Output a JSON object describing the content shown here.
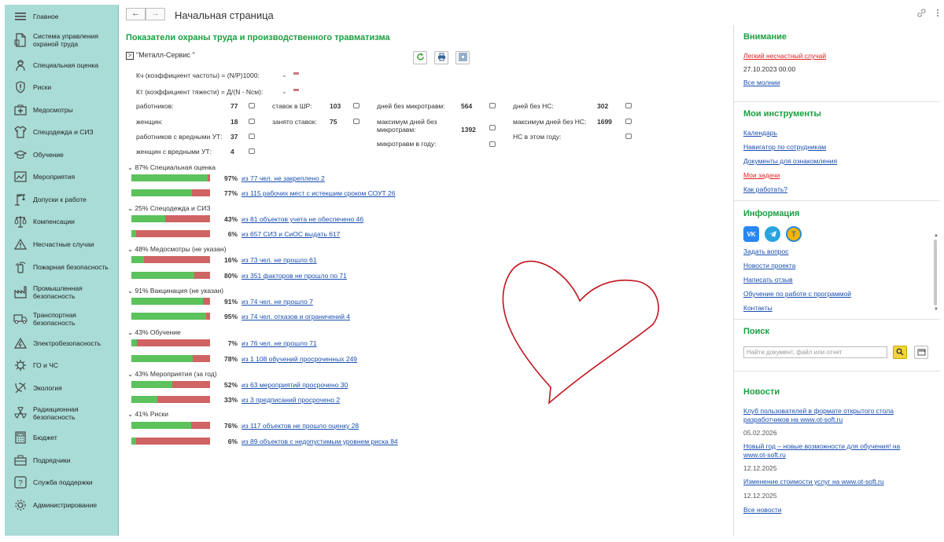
{
  "sidebar": {
    "items": [
      {
        "label": "Главное",
        "icon": "menu-icon"
      },
      {
        "label": "Система управления охраной труда",
        "icon": "document-icon"
      },
      {
        "label": "Специальная оценка",
        "icon": "worker-icon"
      },
      {
        "label": "Риски",
        "icon": "alert-shield-icon"
      },
      {
        "label": "Медосмотры",
        "icon": "medkit-icon"
      },
      {
        "label": "Спецодежда и СИЗ",
        "icon": "clothes-icon"
      },
      {
        "label": "Обучение",
        "icon": "graduation-icon"
      },
      {
        "label": "Мероприятия",
        "icon": "chart-icon"
      },
      {
        "label": "Допуски к работе",
        "icon": "crane-icon"
      },
      {
        "label": "Компенсации",
        "icon": "scales-icon"
      },
      {
        "label": "Несчастные случаи",
        "icon": "warning-icon"
      },
      {
        "label": "Пожарная безопасность",
        "icon": "extinguisher-icon"
      },
      {
        "label": "Промышленная безопасность",
        "icon": "factory-icon"
      },
      {
        "label": "Транспортная безопасность",
        "icon": "truck-icon"
      },
      {
        "label": "Электробезопасность",
        "icon": "lightning-icon"
      },
      {
        "label": "ГО и ЧС",
        "icon": "gear-alert-icon"
      },
      {
        "label": "Экология",
        "icon": "leaf-icon"
      },
      {
        "label": "Радиационная безопасность",
        "icon": "radiation-icon"
      },
      {
        "label": "Бюджет",
        "icon": "calculator-icon"
      },
      {
        "label": "Подрядчики",
        "icon": "briefcase-icon"
      },
      {
        "label": "Служба поддержки",
        "icon": "help-icon"
      },
      {
        "label": "Администрирование",
        "icon": "settings-icon"
      }
    ]
  },
  "header": {
    "back": "←",
    "forward": "→",
    "title": "Начальная страница",
    "link_icon": "link-icon",
    "more_icon": "more-icon"
  },
  "main": {
    "title": "Показатели охраны труда и производственного травматизма",
    "org": "\"Металл-Сервис \"",
    "kch_label": "Кч (коэффициент частоты) = (N/Р)1000:",
    "kch_value": "-",
    "kt_label": "Кт (коэффициент тяжести) = Д/(N - Nсм):",
    "kt_value": "-",
    "stats": [
      {
        "label": "работников:",
        "value": "77"
      },
      {
        "label": "женщин:",
        "value": "18"
      },
      {
        "label": "работников с вредными УТ:",
        "value": "37"
      },
      {
        "label": "женщин с вредными УТ:",
        "value": "4"
      },
      {
        "label": "ставок в ШР:",
        "value": "103"
      },
      {
        "label": "занято ставок:",
        "value": "75"
      },
      {
        "label": "дней без микротравм:",
        "value": "564"
      },
      {
        "label": "максимум дней без микротравм:",
        "value": "1392"
      },
      {
        "label": "микротравм в году:",
        "value": ""
      },
      {
        "label": "дней без НС:",
        "value": "302"
      },
      {
        "label": "максимум дней без НС:",
        "value": "1699"
      },
      {
        "label": "НС в этом году:",
        "value": ""
      }
    ],
    "groups": [
      {
        "title": "87% Специальная оценка",
        "rows": [
          {
            "pct": "97%",
            "fill": 0.97,
            "text": "из 77 чел. не закреплено 2"
          },
          {
            "pct": "77%",
            "fill": 0.77,
            "text": "из 115 рабочих мест с истекшим сроком СОУТ 26"
          }
        ]
      },
      {
        "title": "25% Спецодежда и СИЗ",
        "rows": [
          {
            "pct": "43%",
            "fill": 0.43,
            "text": "из 81 объектов учета не обеспечено 46"
          },
          {
            "pct": "6%",
            "fill": 0.06,
            "text": "из 657 СИЗ и СиОС выдать 617"
          }
        ]
      },
      {
        "title": "48% Медосмотры (не указан)",
        "rows": [
          {
            "pct": "16%",
            "fill": 0.16,
            "text": "из 73 чел. не прошло 61"
          },
          {
            "pct": "80%",
            "fill": 0.8,
            "text": "из 351 факторов не прошло по 71"
          }
        ]
      },
      {
        "title": "91% Вакцинация (не указан)",
        "rows": [
          {
            "pct": "91%",
            "fill": 0.91,
            "text": "из 74 чел. не прошло 7"
          },
          {
            "pct": "95%",
            "fill": 0.95,
            "text": "из 74 чел. отказов и ограничений 4"
          }
        ]
      },
      {
        "title": "43% Обучение",
        "rows": [
          {
            "pct": "7%",
            "fill": 0.07,
            "text": "из 76 чел. не прошло 71"
          },
          {
            "pct": "78%",
            "fill": 0.78,
            "text": "из 1 108 обучений просроченных 249"
          }
        ]
      },
      {
        "title": "43% Мероприятия (за год)",
        "rows": [
          {
            "pct": "52%",
            "fill": 0.52,
            "text": "из 63 мероприятий просрочено 30"
          },
          {
            "pct": "33%",
            "fill": 0.33,
            "text": "из 3 предписаний просрочено 2"
          }
        ]
      },
      {
        "title": "41% Риски",
        "rows": [
          {
            "pct": "76%",
            "fill": 0.76,
            "text": "из 117 объектов не прошло оценку 28"
          },
          {
            "pct": "6%",
            "fill": 0.06,
            "text": "из 89 объектов с недопустимым уровнем риска 84"
          }
        ]
      }
    ]
  },
  "right": {
    "attention": {
      "title": "Внимание",
      "alert": "Легкий несчастный случай",
      "date": "27.10.2023 00:00",
      "all": "Все молнии"
    },
    "tools": {
      "title": "Мои инструменты",
      "items": [
        "Календарь",
        "Навигатор по сотрудникам",
        "Документы для ознакомления",
        "Мои задачи",
        "Как работать?"
      ]
    },
    "info": {
      "title": "Информация",
      "items": [
        "Задать вопрос",
        "Новости проекта",
        "Написать отзыв",
        "Обучение по работе с программой",
        "Контакты"
      ]
    },
    "search": {
      "title": "Поиск",
      "placeholder": "Найти документ, файл или отчет"
    },
    "news": {
      "title": "Новости",
      "items": [
        {
          "text1": "Клуб пользователей в формате открытого стола",
          "text2": "разработчиков на www.ot-soft.ru",
          "date": "05.02.2026"
        },
        {
          "text1": "Новый год – новые возможности для обучения! на",
          "text2": "www.ot-soft.ru",
          "date": "12.12.2025"
        },
        {
          "text1": "Изменение стоимости услуг на www.ot-soft.ru",
          "text2": "",
          "date": "12.12.2025"
        }
      ],
      "all": "Все новости"
    }
  },
  "colors": {
    "sidebar": "#a9dcd6",
    "accent": "#1aa040",
    "link": "#1a4fb0",
    "bar_ok": "#5cc25c",
    "bar_bad": "#d06464",
    "heart": "#c0141c"
  }
}
